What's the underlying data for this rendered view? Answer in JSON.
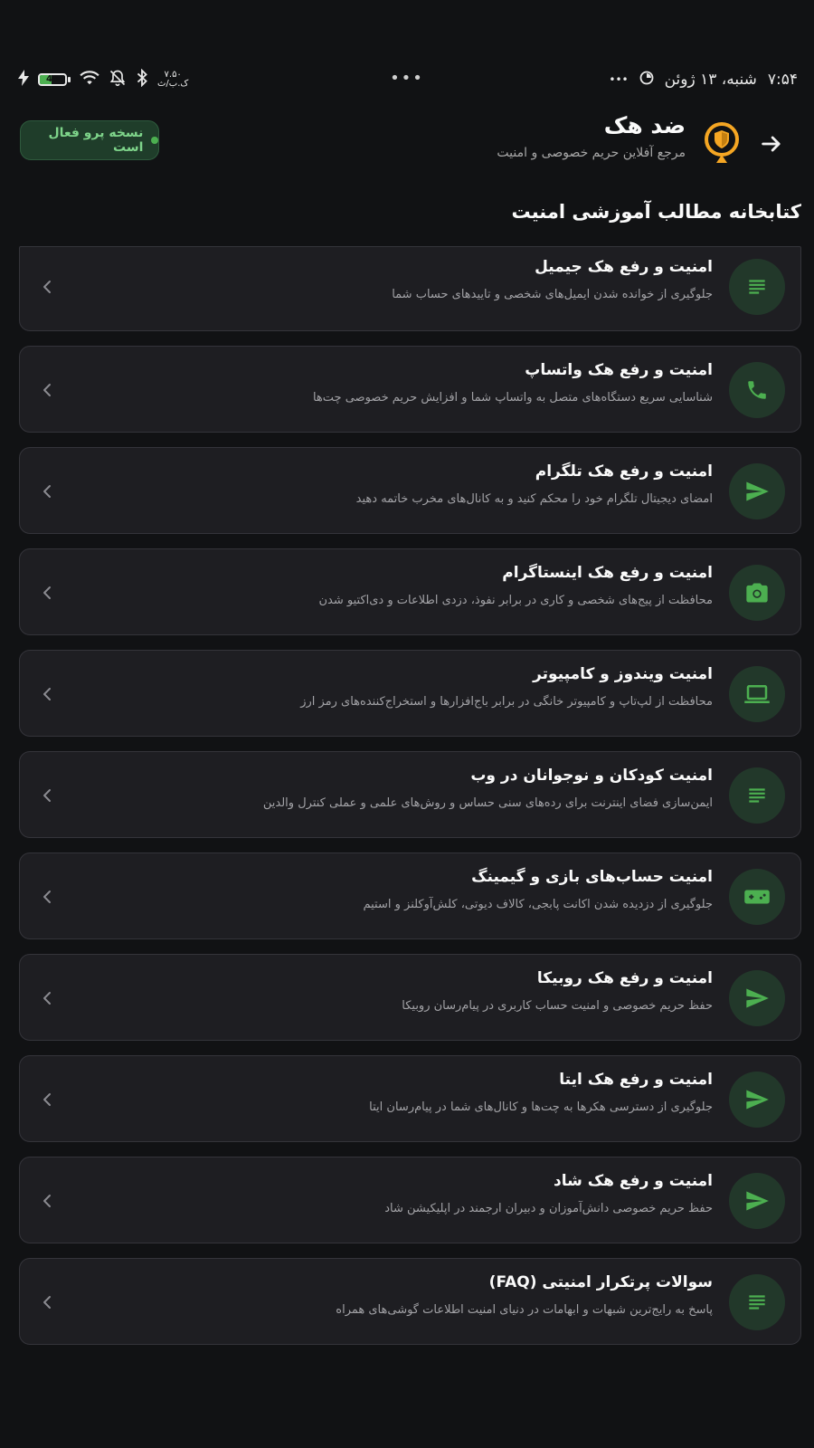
{
  "status_bar": {
    "time": "۷:۵۴",
    "date": "شنبه، ۱۳ ژوئن",
    "more_dots": "•••",
    "center_dots": "•••",
    "battery_level": "46",
    "battery_fraction": 0.46,
    "net_speed_value": "۷.۵۰",
    "net_speed_unit": "ک.ب/ث"
  },
  "header": {
    "title": "ضد هک",
    "subtitle": "مرجع آفلاین حریم خصوصی و امنیت",
    "pro_badge": "نسخه پرو فعال است"
  },
  "section_title": "کتابخانه مطالب آموزشی امنیت",
  "colors": {
    "accent": "#4caf50",
    "logo": "#f5a623",
    "card_bg": "#1e1e22",
    "page_bg": "#111214"
  },
  "articles": [
    {
      "title": "امنیت و رفع هک جیمیل",
      "desc": "جلوگیری از خوانده شدن ایمیل‌های شخصی و تاییدهای حساب شما",
      "icon": "article-icon"
    },
    {
      "title": "امنیت و رفع هک واتساپ",
      "desc": "شناسایی سریع دستگاه‌های متصل به واتساپ شما و افزایش حریم خصوصی چت‌ها",
      "icon": "phone-icon"
    },
    {
      "title": "امنیت و رفع هک تلگرام",
      "desc": "امضای دیجیتال تلگرام خود را محکم کنید و به کانال‌های مخرب خاتمه دهید",
      "icon": "send-icon"
    },
    {
      "title": "امنیت و رفع هک اینستاگرام",
      "desc": "محافظت از پیج‌های شخصی و کاری در برابر نفوذ، دزدی اطلاعات و دی‌اکتیو شدن",
      "icon": "camera-icon"
    },
    {
      "title": "امنیت ویندوز و کامپیوتر",
      "desc": "محافظت از لپ‌تاپ و کامپیوتر خانگی در برابر باج‌افزارها و استخراج‌کننده‌های رمز ارز",
      "icon": "laptop-icon"
    },
    {
      "title": "امنیت کودکان و نوجوانان در وب",
      "desc": "ایمن‌سازی فضای اینترنت برای رده‌های سنی حساس و روش‌های علمی و عملی کنترل والدین",
      "icon": "article-icon"
    },
    {
      "title": "امنیت حساب‌های بازی و گیمینگ",
      "desc": "جلوگیری از دزدیده شدن اکانت پابجی، کالاف دیوتی، کلش‌آوکلنز و استیم",
      "icon": "gamepad-icon"
    },
    {
      "title": "امنیت و رفع هک روبیکا",
      "desc": "حفظ حریم خصوصی و امنیت حساب کاربری در پیام‌رسان روبیکا",
      "icon": "send-icon"
    },
    {
      "title": "امنیت و رفع هک ایتا",
      "desc": "جلوگیری از دسترسی هکرها به چت‌ها و کانال‌های شما در پیام‌رسان ایتا",
      "icon": "send-icon"
    },
    {
      "title": "امنیت و رفع هک شاد",
      "desc": "حفظ حریم خصوصی دانش‌آموزان و دبیران ارجمند در اپلیکیشن شاد",
      "icon": "send-icon"
    },
    {
      "title": "سوالات پرتکرار امنیتی (FAQ)",
      "desc": "پاسخ به رایج‌ترین شبهات و ابهامات در دنیای امنیت اطلاعات گوشی‌های همراه",
      "icon": "article-icon"
    }
  ]
}
